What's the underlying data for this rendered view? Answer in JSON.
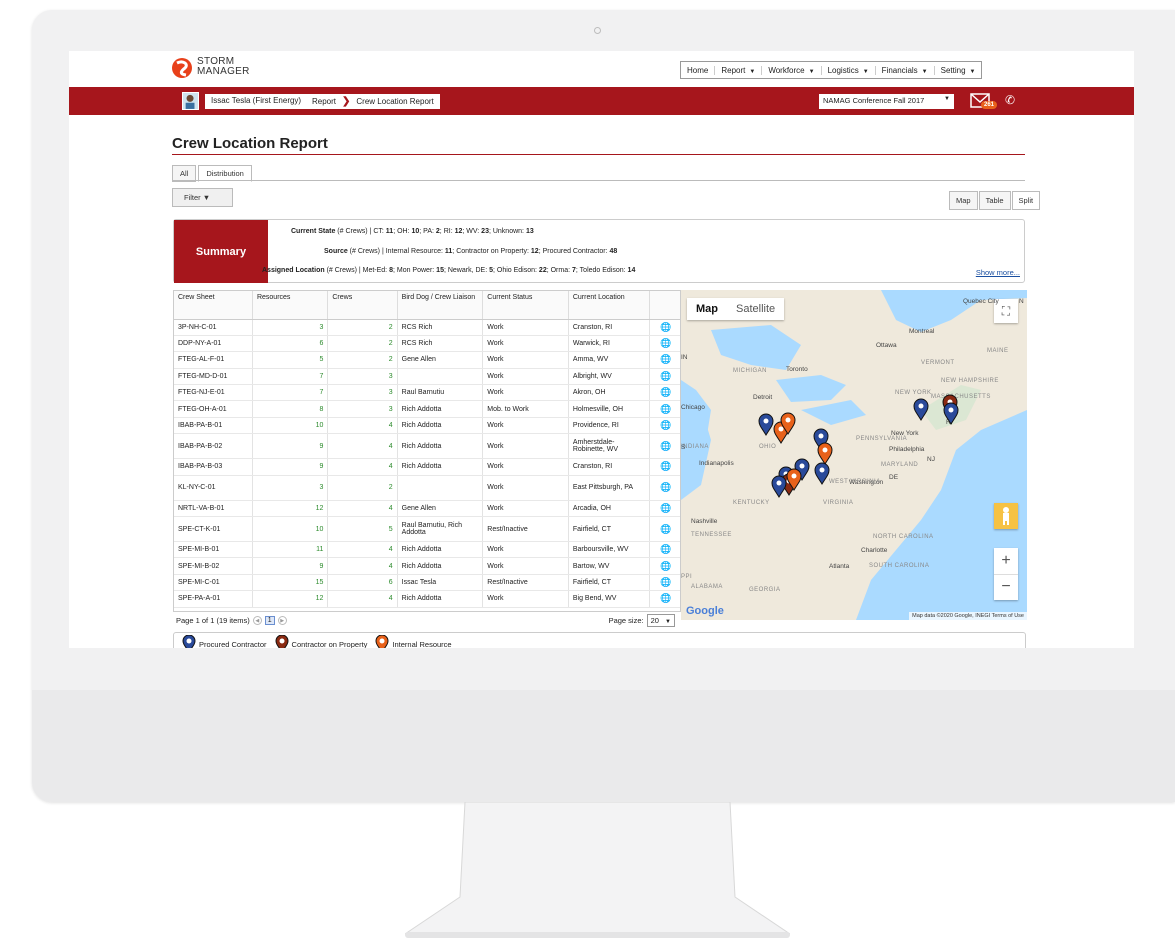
{
  "brand": {
    "line1": "STORM",
    "line2": "MANAGER"
  },
  "topnav": [
    {
      "label": "Home",
      "dropdown": false
    },
    {
      "label": "Report",
      "dropdown": true
    },
    {
      "label": "Workforce",
      "dropdown": true
    },
    {
      "label": "Logistics",
      "dropdown": true
    },
    {
      "label": "Financials",
      "dropdown": true
    },
    {
      "label": "Setting",
      "dropdown": true
    }
  ],
  "redbar": {
    "user": "Issac Tesla (First Energy)",
    "breadcrumb": [
      "Report",
      "Crew Location Report"
    ],
    "event": "NAMAG Conference Fall 2017",
    "mail_count": "261"
  },
  "page_title": "Crew Location Report",
  "tabs": [
    "All",
    "Distribution"
  ],
  "filter_label": "Filter",
  "view_buttons": [
    "Map",
    "Table",
    "Split"
  ],
  "summary": {
    "label": "Summary",
    "current_state": {
      "key": "Current State",
      "unit": "(# Crews) |",
      "items": [
        [
          "CT:",
          "11"
        ],
        [
          "OH:",
          "10"
        ],
        [
          "PA:",
          "2"
        ],
        [
          "RI:",
          "12"
        ],
        [
          "WV:",
          "23"
        ],
        [
          "Unknown:",
          "13"
        ]
      ]
    },
    "source": {
      "key": "Source",
      "unit": "(# Crews) |",
      "items": [
        [
          "Internal Resource:",
          "11"
        ],
        [
          "Contractor on Property:",
          "12"
        ],
        [
          "Procured Contractor:",
          "48"
        ]
      ]
    },
    "assigned_location": {
      "key": "Assigned Location",
      "unit": "(# Crews) |",
      "items": [
        [
          "Met-Ed:",
          "8"
        ],
        [
          "Mon Power:",
          "15"
        ],
        [
          "Newark, DE:",
          "5"
        ],
        [
          "Ohio Edison:",
          "22"
        ],
        [
          "Orma:",
          "7"
        ],
        [
          "Toledo Edison:",
          "14"
        ]
      ]
    },
    "show_more": "Show more..."
  },
  "table": {
    "columns": [
      "Crew Sheet",
      "Resources",
      "Crews",
      "Bird Dog / Crew Liaison",
      "Current Status",
      "Current Location",
      ""
    ],
    "rows": [
      [
        "3P-NH-C-01",
        "3",
        "2",
        "RCS Rich",
        "Work",
        "Cranston, RI"
      ],
      [
        "DDP-NY-A-01",
        "6",
        "2",
        "RCS Rich",
        "Work",
        "Warwick, RI"
      ],
      [
        "FTEG-AL-F-01",
        "5",
        "2",
        "Gene Allen",
        "Work",
        "Amma, WV"
      ],
      [
        "FTEG-MD-D-01",
        "7",
        "3",
        "",
        "Work",
        "Albright, WV"
      ],
      [
        "FTEG-NJ-E-01",
        "7",
        "3",
        "Raul Barnutiu",
        "Work",
        "Akron, OH"
      ],
      [
        "FTEG-OH-A-01",
        "8",
        "3",
        "Rich Addotta",
        "Mob. to Work",
        "Holmesville, OH"
      ],
      [
        "IBAB-PA-B-01",
        "10",
        "4",
        "Rich Addotta",
        "Work",
        "Providence, RI"
      ],
      [
        "IBAB-PA-B-02",
        "9",
        "4",
        "Rich Addotta",
        "Work",
        "Amherstdale-Robinette, WV"
      ],
      [
        "IBAB-PA-B-03",
        "9",
        "4",
        "Rich Addotta",
        "Work",
        "Cranston, RI"
      ],
      [
        "KL-NY-C-01",
        "3",
        "2",
        "",
        "Work",
        "East Pittsburgh, PA"
      ],
      [
        "NRTL-VA-B-01",
        "12",
        "4",
        "Gene Allen",
        "Work",
        "Arcadia, OH"
      ],
      [
        "SPE-CT-K-01",
        "10",
        "5",
        "Raul Barnutiu, Rich Addotta",
        "Rest/Inactive",
        "Fairfield, CT"
      ],
      [
        "SPE-MI-B-01",
        "11",
        "4",
        "Rich Addotta",
        "Work",
        "Barboursville, WV"
      ],
      [
        "SPE-MI-B-02",
        "9",
        "4",
        "Rich Addotta",
        "Work",
        "Bartow, WV"
      ],
      [
        "SPE-MI-C-01",
        "15",
        "6",
        "Issac Tesla",
        "Rest/Inactive",
        "Fairfield, CT"
      ],
      [
        "SPE-PA-A-01",
        "12",
        "4",
        "Rich Addotta",
        "Work",
        "Big Bend, WV"
      ]
    ]
  },
  "pager": {
    "info": "Page 1 of 1 (19 items)",
    "page": "1",
    "size_label": "Page size:",
    "size": "20"
  },
  "map": {
    "tabs": [
      "Map",
      "Satellite"
    ],
    "labels": [
      "Quebec City",
      "Montreal",
      "Ottawa",
      "MAINE",
      "VERMONT",
      "NEW HAMPSHIRE",
      "MASSACHUSETTS",
      "MICHIGAN",
      "Toronto",
      "NEW YORK",
      "Detroit",
      "Chicago",
      "INDIANA",
      "OHIO",
      "PENNSYLVANIA",
      "New York",
      "Philadelphia",
      "Indianapolis",
      "MARYLAND",
      "NJ",
      "DE",
      "Washington",
      "KENTUCKY",
      "VIRGINIA",
      "Nashville",
      "TENNESSEE",
      "NORTH CAROLINA",
      "Charlotte",
      "SOUTH CAROLINA",
      "Atlanta",
      "ALABAMA",
      "GEORGIA",
      "RI",
      "N",
      "IN",
      "S",
      "PPI",
      "WEST VIRGINIA"
    ],
    "attribution": "Map data ©2020 Google, INEGI   Terms of Use",
    "google": "Google"
  },
  "legend": [
    {
      "label": "Procured Contractor",
      "color": "#2a4a9a"
    },
    {
      "label": "Contractor on Property",
      "color": "#8a2a12"
    },
    {
      "label": "Internal Resource",
      "color": "#e8611a"
    }
  ],
  "colors": {
    "brand_red": "#a6161c",
    "accent_orange": "#e8611a",
    "link_blue": "#1a4fa0",
    "value_green": "#2b8a2b"
  }
}
